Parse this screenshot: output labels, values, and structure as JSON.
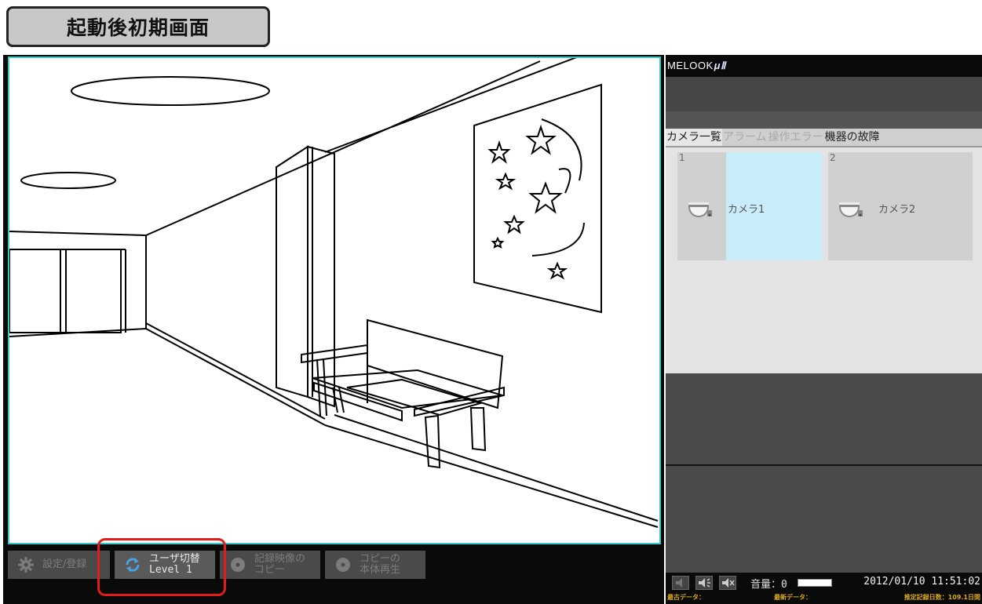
{
  "title": "起動後初期画面",
  "toolbar": {
    "settings_label": "設定/登録",
    "user_switch_line1": "ユーザ切替",
    "user_switch_line2": "Level 1",
    "record_copy_line1": "記録映像の",
    "record_copy_line2": "コピー",
    "copy_play_line1": "コピーの",
    "copy_play_line2": "本体再生"
  },
  "right_panel": {
    "logo_text": "MELOOK",
    "logo_mu": "μⅡ",
    "tabs": [
      "カメラ一覧",
      "アラーム",
      "操作エラー",
      "機器の故障"
    ],
    "cameras": [
      {
        "number": "1",
        "name": "カメラ1",
        "selected": true
      },
      {
        "number": "2",
        "name": "カメラ2",
        "selected": false
      }
    ],
    "volume_label": "音量：",
    "volume_value": "0",
    "datetime": "2012/01/10 11:51:02",
    "oldest_data": "最古データ：",
    "newest_data": "最新データ：",
    "estimated_days": "推定記録日数：109.1日間"
  },
  "colors": {
    "viewer_border": "#37c8c8",
    "highlight": "#e21b1b",
    "selected_camera": "#c9ecfb"
  }
}
